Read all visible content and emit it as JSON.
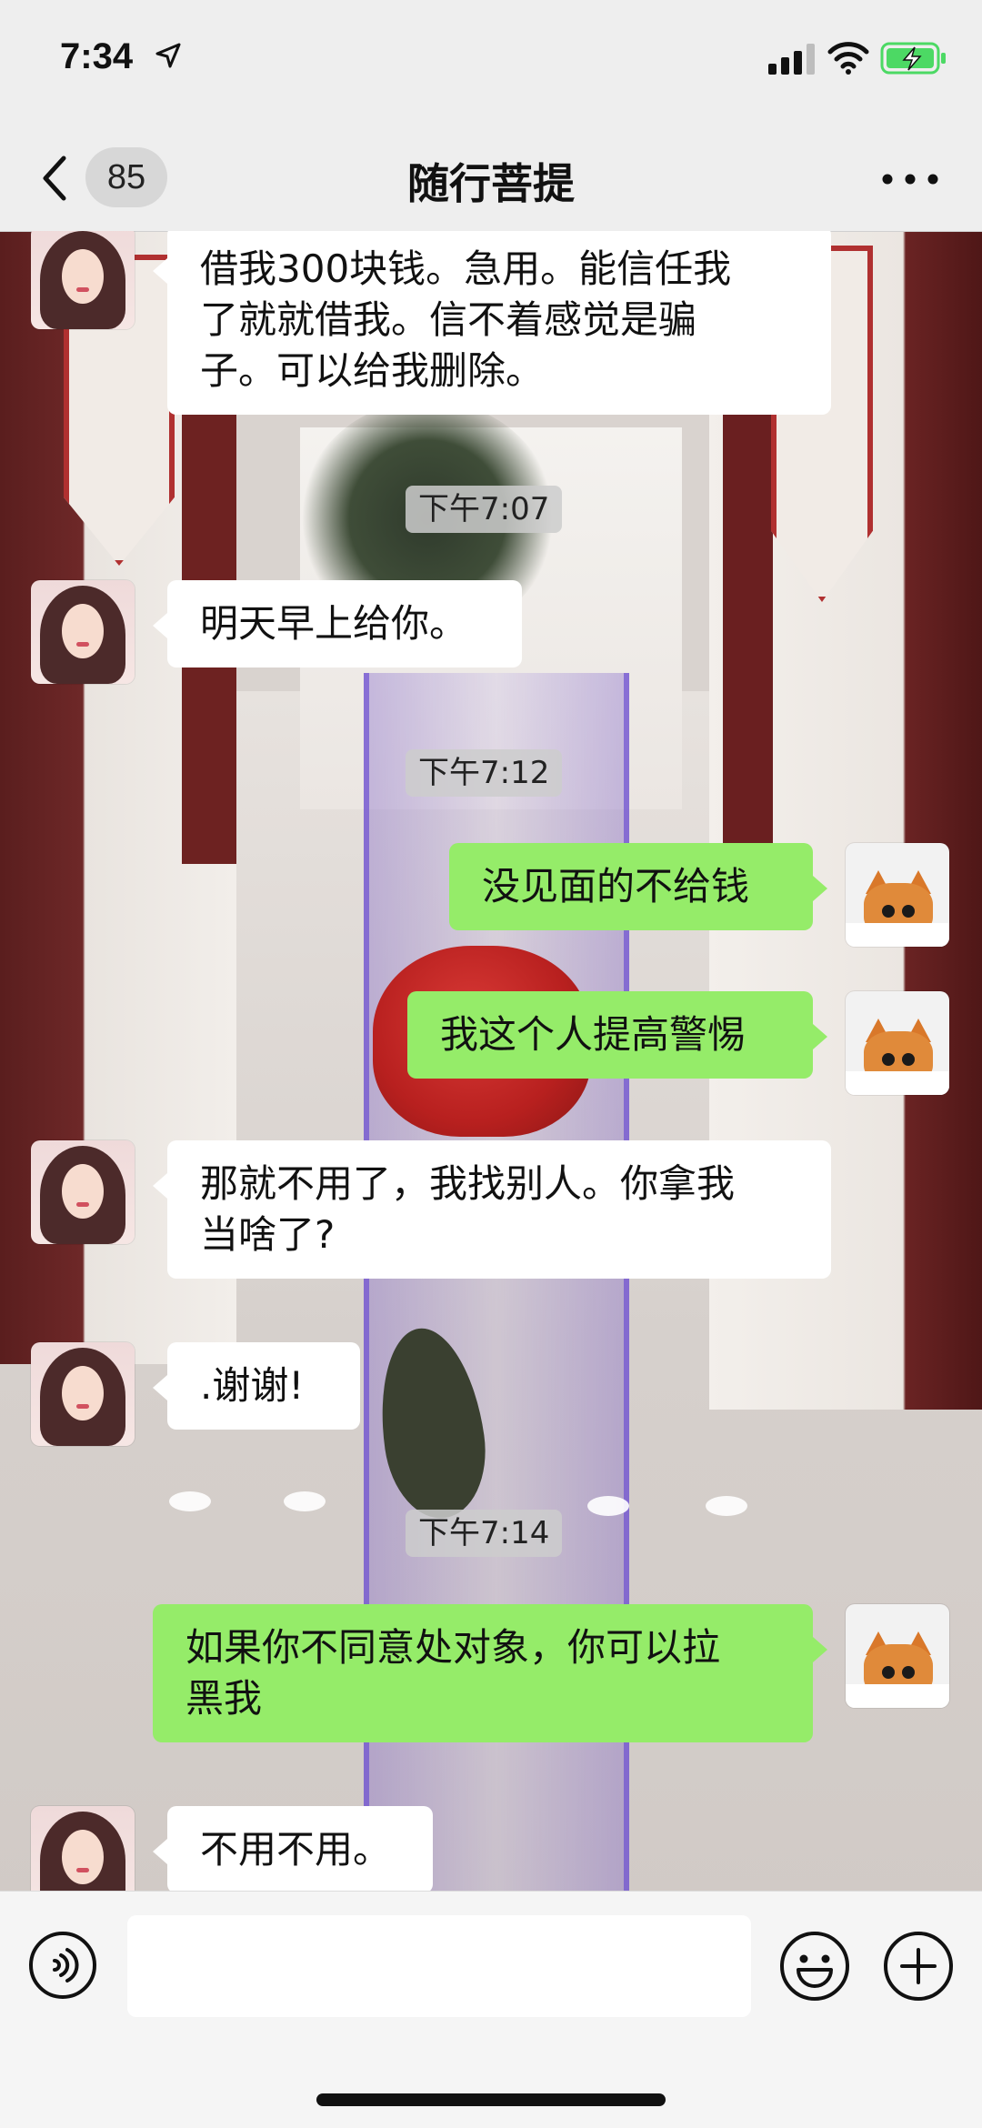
{
  "status_bar": {
    "time": "7:34",
    "icons": [
      "location-arrow-icon",
      "signal-icon",
      "wifi-icon",
      "battery-charging-icon"
    ]
  },
  "nav": {
    "back_icon": "chevron-left-icon",
    "unread_count": "85",
    "title": "随行菩提",
    "more_icon": "more-icon"
  },
  "messages": [
    {
      "type": "text",
      "side": "left",
      "sender": "contact",
      "lines": [
        "借我300块钱。急用。能信任我",
        "了就就借我。信不着感觉是骗",
        "子。可以给我删除。"
      ]
    },
    {
      "type": "time",
      "text": "下午7:07"
    },
    {
      "type": "text",
      "side": "left",
      "sender": "contact",
      "lines": [
        "明天早上给你。"
      ]
    },
    {
      "type": "time",
      "text": "下午7:12"
    },
    {
      "type": "text",
      "side": "right",
      "sender": "me",
      "lines": [
        "没见面的不给钱"
      ]
    },
    {
      "type": "text",
      "side": "right",
      "sender": "me",
      "lines": [
        "我这个人提高警惕"
      ]
    },
    {
      "type": "text",
      "side": "left",
      "sender": "contact",
      "lines": [
        "那就不用了，我找别人。你拿我",
        "当啥了?"
      ]
    },
    {
      "type": "text",
      "side": "left",
      "sender": "contact",
      "lines": [
        ".谢谢!"
      ]
    },
    {
      "type": "time",
      "text": "下午7:14"
    },
    {
      "type": "text",
      "side": "right",
      "sender": "me",
      "lines": [
        "如果你不同意处对象，你可以拉",
        "黑我"
      ]
    },
    {
      "type": "text",
      "side": "left",
      "sender": "contact",
      "lines": [
        "不用不用。"
      ]
    }
  ],
  "input_bar": {
    "voice_icon": "voice-icon",
    "input_value": "",
    "emoji_icon": "emoji-icon",
    "plus_icon": "plus-icon"
  },
  "colors": {
    "bar_bg": "#eeeeee",
    "bubble_me": "#95ec69",
    "bubble_contact": "#ffffff",
    "battery_green": "#4cd964"
  }
}
